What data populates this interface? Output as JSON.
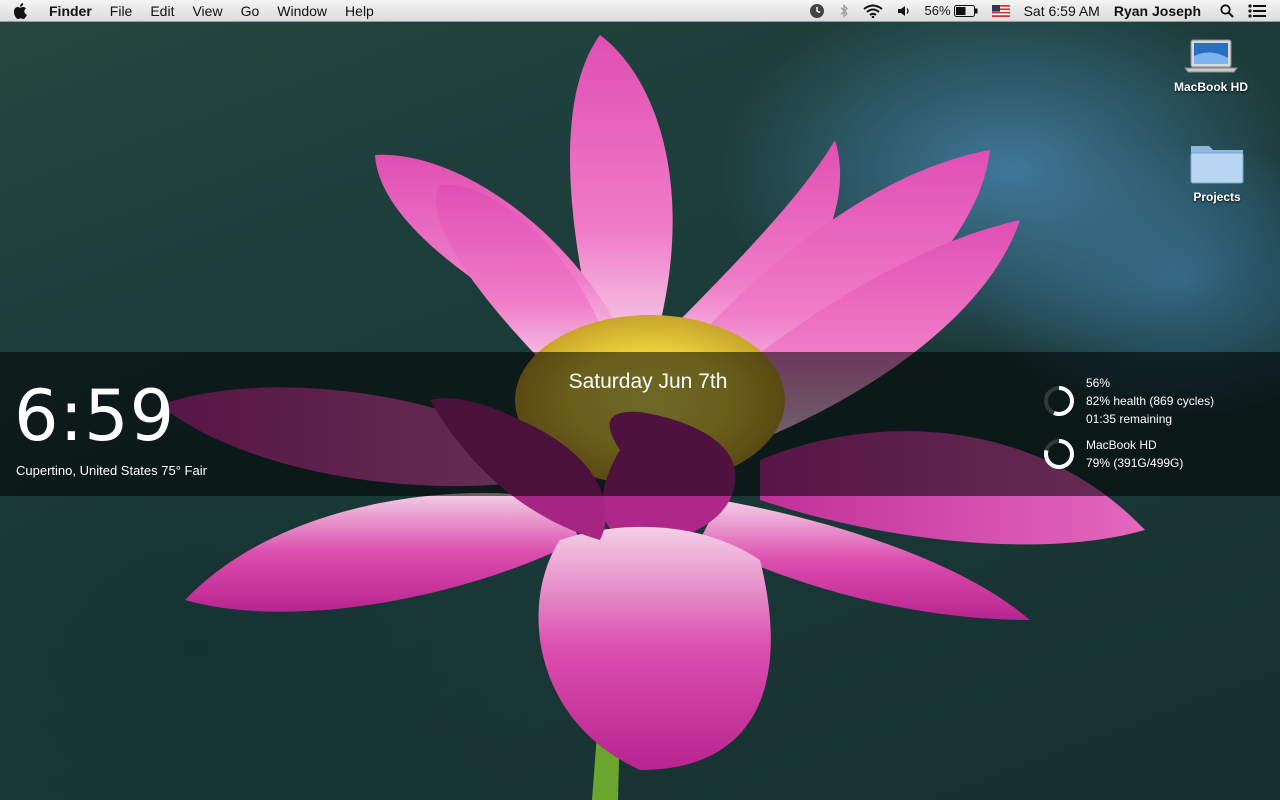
{
  "menubar": {
    "app_name": "Finder",
    "menus": [
      "File",
      "Edit",
      "View",
      "Go",
      "Window",
      "Help"
    ],
    "battery_percent": "56%",
    "clock": "Sat 6:59 AM",
    "user": "Ryan Joseph"
  },
  "desktop_icons": [
    {
      "label": "MacBook HD",
      "icon": "hard-drive-icon"
    },
    {
      "label": "Projects",
      "icon": "folder-icon"
    }
  ],
  "widget": {
    "time": "6:59",
    "weather": "Cupertino, United States 75° Fair",
    "date": "Saturday Jun 7th",
    "battery": {
      "level": 0.56,
      "line1": "56%",
      "line2": "82% health (869 cycles)",
      "line3": "01:35 remaining"
    },
    "disk": {
      "level": 0.79,
      "line1": "MacBook HD",
      "line2": "79% (391G/499G)"
    }
  },
  "colors": {
    "menubar": "#e8e8e8",
    "petal": "#d53aa3",
    "flower_center": "#f2e24a",
    "band": "#000000"
  }
}
